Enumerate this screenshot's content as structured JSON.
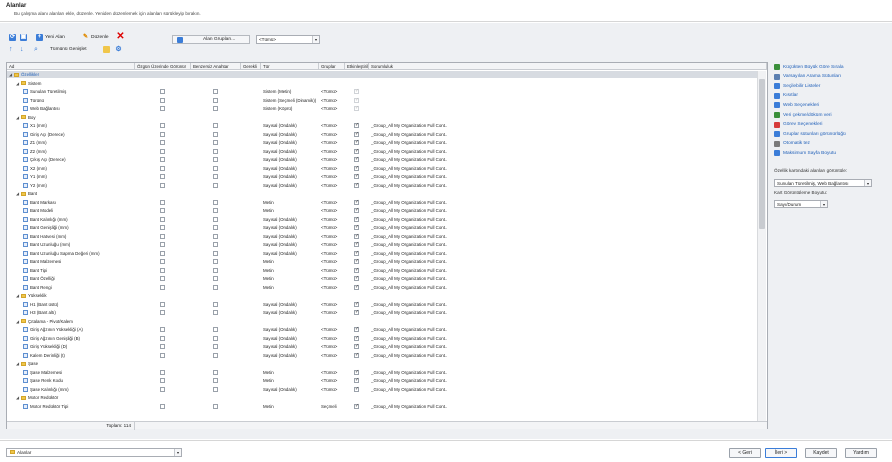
{
  "header": {
    "title": "Alanlar",
    "subtitle": "Bu çalışma alanı alanları ekle, düzenle. Yeniden düzenlemek için alanları sürükleyip bırakın."
  },
  "toolbar": {
    "new_label": "Yeni Alan",
    "edit_label": "Düzenle",
    "all_expand_label": "Tümünü Genişlet",
    "group_label": "Alan Grupları...",
    "type_value": "<Tümü>"
  },
  "columns": [
    "Ad",
    "Özgün Üzerinde Görünür",
    "Benzersiz Anahtar",
    "Gerekli",
    "Tür",
    "Gruplar",
    "Etkinleştirildi",
    "Sorumluluk"
  ],
  "rows": [
    {
      "name": "Özellikler",
      "lvl": 0,
      "kind": "folder",
      "sel": true,
      "vis": null,
      "uniq": null,
      "req": null,
      "type": "",
      "grp": "",
      "act": null,
      "resp": ""
    },
    {
      "name": "Sistem",
      "lvl": 1,
      "kind": "folder",
      "vis": null,
      "uniq": null,
      "req": null,
      "type": "",
      "grp": "",
      "act": null,
      "resp": ""
    },
    {
      "name": "Sunulan Türetilmiş",
      "lvl": 2,
      "kind": "field",
      "vis": false,
      "uniq": false,
      "req": null,
      "type": "Sistem (Metin)",
      "grp": "<Tümü>",
      "act": "dis",
      "resp": ""
    },
    {
      "name": "Türünü",
      "lvl": 2,
      "kind": "field",
      "vis": false,
      "uniq": false,
      "req": null,
      "type": "Sistem (Seçmeli (Dinamik))",
      "grp": "<Tümü>",
      "act": "dis",
      "resp": ""
    },
    {
      "name": "Web Bağlantısı",
      "lvl": 2,
      "kind": "field",
      "vis": false,
      "uniq": false,
      "req": null,
      "type": "Sistem (Köprü)",
      "grp": "<Tümü>",
      "act": "dis",
      "resp": ""
    },
    {
      "name": "Boy",
      "lvl": 1,
      "kind": "folder",
      "vis": null,
      "uniq": null,
      "req": null,
      "type": "",
      "grp": "",
      "act": null,
      "resp": ""
    },
    {
      "name": "X1 (mm)",
      "lvl": 2,
      "kind": "field",
      "vis": false,
      "uniq": false,
      "req": null,
      "type": "Sayısal (Ondalık)",
      "grp": "<Tümü>",
      "act": true,
      "resp": "_Group_All My Organization Full Cont.."
    },
    {
      "name": "Giriş Açı (Derece)",
      "lvl": 2,
      "kind": "field",
      "vis": false,
      "uniq": false,
      "req": null,
      "type": "Sayısal (Ondalık)",
      "grp": "<Tümü>",
      "act": true,
      "resp": "_Group_All My Organization Full Cont.."
    },
    {
      "name": "Z1 (mm)",
      "lvl": 2,
      "kind": "field",
      "vis": false,
      "uniq": false,
      "req": null,
      "type": "Sayısal (Ondalık)",
      "grp": "<Tümü>",
      "act": true,
      "resp": "_Group_All My Organization Full Cont.."
    },
    {
      "name": "Z2 (mm)",
      "lvl": 2,
      "kind": "field",
      "vis": false,
      "uniq": false,
      "req": null,
      "type": "Sayısal (Ondalık)",
      "grp": "<Tümü>",
      "act": true,
      "resp": "_Group_All My Organization Full Cont.."
    },
    {
      "name": "Çıkış Açı (Derece)",
      "lvl": 2,
      "kind": "field",
      "vis": false,
      "uniq": false,
      "req": null,
      "type": "Sayısal (Ondalık)",
      "grp": "<Tümü>",
      "act": true,
      "resp": "_Group_All My Organization Full Cont.."
    },
    {
      "name": "X2 (mm)",
      "lvl": 2,
      "kind": "field",
      "vis": false,
      "uniq": false,
      "req": null,
      "type": "Sayısal (Ondalık)",
      "grp": "<Tümü>",
      "act": true,
      "resp": "_Group_All My Organization Full Cont.."
    },
    {
      "name": "Y1 (mm)",
      "lvl": 2,
      "kind": "field",
      "vis": false,
      "uniq": false,
      "req": null,
      "type": "Sayısal (Ondalık)",
      "grp": "<Tümü>",
      "act": true,
      "resp": "_Group_All My Organization Full Cont.."
    },
    {
      "name": "Y2 (mm)",
      "lvl": 2,
      "kind": "field",
      "vis": false,
      "uniq": false,
      "req": null,
      "type": "Sayısal (Ondalık)",
      "grp": "<Tümü>",
      "act": true,
      "resp": "_Group_All My Organization Full Cont.."
    },
    {
      "name": "Bant",
      "lvl": 1,
      "kind": "folder",
      "vis": null,
      "uniq": null,
      "req": null,
      "type": "",
      "grp": "",
      "act": null,
      "resp": ""
    },
    {
      "name": "Bant Markası",
      "lvl": 2,
      "kind": "field",
      "vis": false,
      "uniq": false,
      "req": null,
      "type": "Metin",
      "grp": "<Tümü>",
      "act": true,
      "resp": "_Group_All My Organization Full Cont.."
    },
    {
      "name": "Bant Modeli",
      "lvl": 2,
      "kind": "field",
      "vis": false,
      "uniq": false,
      "req": null,
      "type": "Metin",
      "grp": "<Tümü>",
      "act": true,
      "resp": "_Group_All My Organization Full Cont.."
    },
    {
      "name": "Bant Kalınlığı (mm)",
      "lvl": 2,
      "kind": "field",
      "vis": false,
      "uniq": false,
      "req": null,
      "type": "Sayısal (Ondalık)",
      "grp": "<Tümü>",
      "act": true,
      "resp": "_Group_All My Organization Full Cont.."
    },
    {
      "name": "Bant Genişliği (mm)",
      "lvl": 2,
      "kind": "field",
      "vis": false,
      "uniq": false,
      "req": null,
      "type": "Sayısal (Ondalık)",
      "grp": "<Tümü>",
      "act": true,
      "resp": "_Group_All My Organization Full Cont.."
    },
    {
      "name": "Bant Hatvesi (mm)",
      "lvl": 2,
      "kind": "field",
      "vis": false,
      "uniq": false,
      "req": null,
      "type": "Sayısal (Ondalık)",
      "grp": "<Tümü>",
      "act": true,
      "resp": "_Group_All My Organization Full Cont.."
    },
    {
      "name": "Bant Uzunluğu (mm)",
      "lvl": 2,
      "kind": "field",
      "vis": false,
      "uniq": false,
      "req": null,
      "type": "Sayısal (Ondalık)",
      "grp": "<Tümü>",
      "act": true,
      "resp": "_Group_All My Organization Full Cont.."
    },
    {
      "name": "Bant Uzunluğu Sapma Değeri (mm)",
      "lvl": 2,
      "kind": "field",
      "vis": false,
      "uniq": false,
      "req": null,
      "type": "Sayısal (Ondalık)",
      "grp": "<Tümü>",
      "act": true,
      "resp": "_Group_All My Organization Full Cont.."
    },
    {
      "name": "Bant Malzemesi",
      "lvl": 2,
      "kind": "field",
      "vis": false,
      "uniq": false,
      "req": null,
      "type": "Metin",
      "grp": "<Tümü>",
      "act": true,
      "resp": "_Group_All My Organization Full Cont.."
    },
    {
      "name": "Bant Tipi",
      "lvl": 2,
      "kind": "field",
      "vis": false,
      "uniq": false,
      "req": null,
      "type": "Metin",
      "grp": "<Tümü>",
      "act": true,
      "resp": "_Group_All My Organization Full Cont.."
    },
    {
      "name": "Bant Özelliği",
      "lvl": 2,
      "kind": "field",
      "vis": false,
      "uniq": false,
      "req": null,
      "type": "Metin",
      "grp": "<Tümü>",
      "act": true,
      "resp": "_Group_All My Organization Full Cont.."
    },
    {
      "name": "Bant Rengi",
      "lvl": 2,
      "kind": "field",
      "vis": false,
      "uniq": false,
      "req": null,
      "type": "Metin",
      "grp": "<Tümü>",
      "act": true,
      "resp": "_Group_All My Organization Full Cont.."
    },
    {
      "name": "Yükseklik",
      "lvl": 1,
      "kind": "folder",
      "vis": null,
      "uniq": null,
      "req": null,
      "type": "",
      "grp": "",
      "act": null,
      "resp": ""
    },
    {
      "name": "H1 (Bant üstü)",
      "lvl": 2,
      "kind": "field",
      "vis": false,
      "uniq": false,
      "req": null,
      "type": "Sayısal (Ondalık)",
      "grp": "<Tümü>",
      "act": true,
      "resp": "_Group_All My Organization Full Cont.."
    },
    {
      "name": "H3 (Bant altı)",
      "lvl": 2,
      "kind": "field",
      "vis": false,
      "uniq": false,
      "req": null,
      "type": "Sayısal (Ondalık)",
      "grp": "<Tümü>",
      "act": true,
      "resp": "_Group_All My Organization Full Cont.."
    },
    {
      "name": "Çıtalama - Pivot/Kalem",
      "lvl": 1,
      "kind": "folder",
      "vis": null,
      "uniq": null,
      "req": null,
      "type": "",
      "grp": "",
      "act": null,
      "resp": ""
    },
    {
      "name": "Giriş Ağzının Yüksekliği (A)",
      "lvl": 2,
      "kind": "field",
      "vis": false,
      "uniq": false,
      "req": null,
      "type": "Sayısal (Ondalık)",
      "grp": "<Tümü>",
      "act": true,
      "resp": "_Group_All My Organization Full Cont.."
    },
    {
      "name": "Giriş Ağzının Genişliği (B)",
      "lvl": 2,
      "kind": "field",
      "vis": false,
      "uniq": false,
      "req": null,
      "type": "Sayısal (Ondalık)",
      "grp": "<Tümü>",
      "act": true,
      "resp": "_Group_All My Organization Full Cont.."
    },
    {
      "name": "Giriş Yüksekliği (D)",
      "lvl": 2,
      "kind": "field",
      "vis": false,
      "uniq": false,
      "req": null,
      "type": "Sayısal (Ondalık)",
      "grp": "<Tümü>",
      "act": true,
      "resp": "_Group_All My Organization Full Cont.."
    },
    {
      "name": "Kalem Derinliği (t)",
      "lvl": 2,
      "kind": "field",
      "vis": false,
      "uniq": false,
      "req": null,
      "type": "Sayısal (Ondalık)",
      "grp": "<Tümü>",
      "act": true,
      "resp": "_Group_All My Organization Full Cont.."
    },
    {
      "name": "Şase",
      "lvl": 1,
      "kind": "folder",
      "vis": null,
      "uniq": null,
      "req": null,
      "type": "",
      "grp": "",
      "act": null,
      "resp": ""
    },
    {
      "name": "Şase Malzemesi",
      "lvl": 2,
      "kind": "field",
      "vis": false,
      "uniq": false,
      "req": null,
      "type": "Metin",
      "grp": "<Tümü>",
      "act": true,
      "resp": "_Group_All My Organization Full Cont.."
    },
    {
      "name": "Şase Renk Kodu",
      "lvl": 2,
      "kind": "field",
      "vis": false,
      "uniq": false,
      "req": null,
      "type": "Metin",
      "grp": "<Tümü>",
      "act": true,
      "resp": "_Group_All My Organization Full Cont.."
    },
    {
      "name": "Şase Kalınlığı (mm)",
      "lvl": 2,
      "kind": "field",
      "vis": false,
      "uniq": false,
      "req": null,
      "type": "Sayısal (Ondalık)",
      "grp": "<Tümü>",
      "act": true,
      "resp": "_Group_All My Organization Full Cont.."
    },
    {
      "name": "Motor Redüktör",
      "lvl": 1,
      "kind": "folder",
      "vis": null,
      "uniq": null,
      "req": null,
      "type": "",
      "grp": "",
      "act": null,
      "resp": ""
    },
    {
      "name": "Motor Redüktör Tipi",
      "lvl": 2,
      "kind": "field",
      "vis": false,
      "uniq": false,
      "req": null,
      "type": "Metin",
      "grp": "Seçmeli",
      "act": true,
      "resp": "_Group_All My Organization Full Cont.."
    }
  ],
  "footer": {
    "total": "Toplam: 114"
  },
  "side": {
    "links": [
      {
        "label": "Küçükten Büyük Göre Sırala",
        "icon": "sort-icon",
        "color": "#3a8f3a"
      },
      {
        "label": "Varsayılan Arama Sütunları",
        "icon": "search-icon",
        "color": "#5b7fb0"
      },
      {
        "label": "Seçilebilir Listeler",
        "icon": "list-icon",
        "color": "#3b7dd8"
      },
      {
        "label": "Kısıtlar",
        "icon": "constraint-icon",
        "color": "#3b7dd8"
      },
      {
        "label": "Web Seçenekleri",
        "icon": "globe-icon",
        "color": "#3b7dd8"
      },
      {
        "label": "Veri çekme/döküm veri",
        "icon": "pull-icon",
        "color": "#3a8f3a"
      },
      {
        "label": "Görev Seçenekleri",
        "icon": "task-icon",
        "color": "#d63b3b"
      },
      {
        "label": "Gruplar sütunları görünürlüğü",
        "icon": "columns-icon",
        "color": "#3b7dd8"
      },
      {
        "label": "Otomatik tez",
        "icon": "auto-icon",
        "color": "#7a7a7a"
      },
      {
        "label": "Maksimum Sayfa Boyutu",
        "icon": "page-size-icon",
        "color": "#3b7dd8"
      }
    ],
    "desc": "Özellik kartındaki alanları görüntüle:",
    "prop_value": "Sunulan Türetilmiş, Web Bağlantısı",
    "font_label": "Kart Görüntüleme Boyutu:",
    "font_value": "Sayı/Durum"
  },
  "bottom": {
    "select_value": "Alanlar",
    "back": "< Geri",
    "next": "İleri >",
    "save": "Kaydet",
    "help": "Yardım"
  }
}
